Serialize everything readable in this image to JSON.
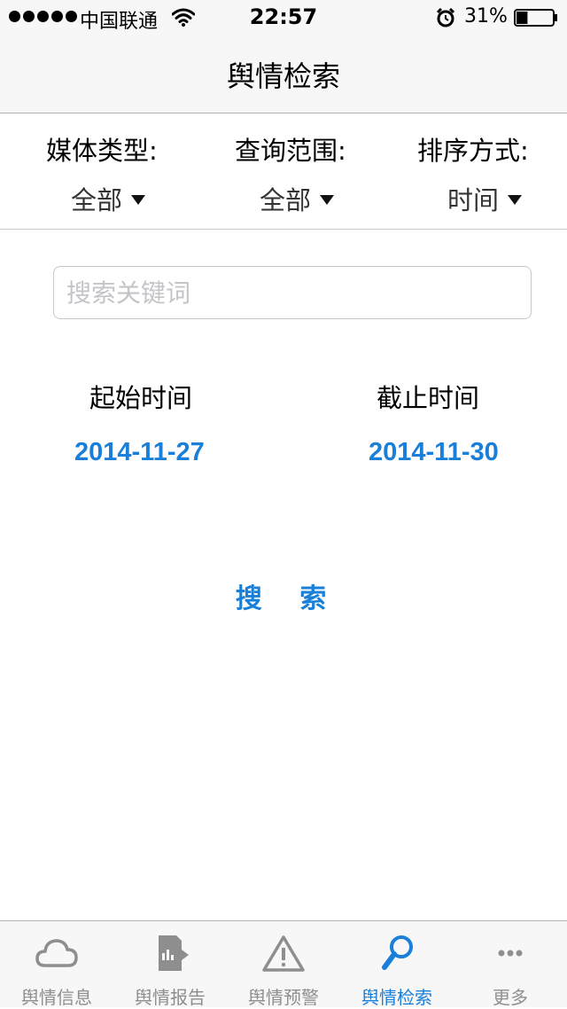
{
  "status_bar": {
    "carrier": "中国联通",
    "time": "22:57",
    "battery_percent": "31%",
    "battery_level": 0.31
  },
  "nav": {
    "title": "舆情检索"
  },
  "filters": {
    "media_type_label": "媒体类型:",
    "media_type_value": "全部",
    "scope_label": "查询范围:",
    "scope_value": "全部",
    "sort_label": "排序方式:",
    "sort_value": "时间"
  },
  "search": {
    "placeholder": "搜索关键词",
    "value": ""
  },
  "dates": {
    "start_label": "起始时间",
    "start_value": "2014-11-27",
    "end_label": "截止时间",
    "end_value": "2014-11-30"
  },
  "actions": {
    "search_button": "搜 索"
  },
  "tabs": [
    {
      "label": "舆情信息",
      "icon": "cloud-icon",
      "active": false
    },
    {
      "label": "舆情报告",
      "icon": "report-icon",
      "active": false
    },
    {
      "label": "舆情预警",
      "icon": "warning-icon",
      "active": false
    },
    {
      "label": "舆情检索",
      "icon": "search-icon",
      "active": true
    },
    {
      "label": "更多",
      "icon": "more-icon",
      "active": false
    }
  ],
  "colors": {
    "accent": "#1a7fd8",
    "tab_inactive": "#8e8e8e",
    "bar_background": "#f7f7f7"
  }
}
